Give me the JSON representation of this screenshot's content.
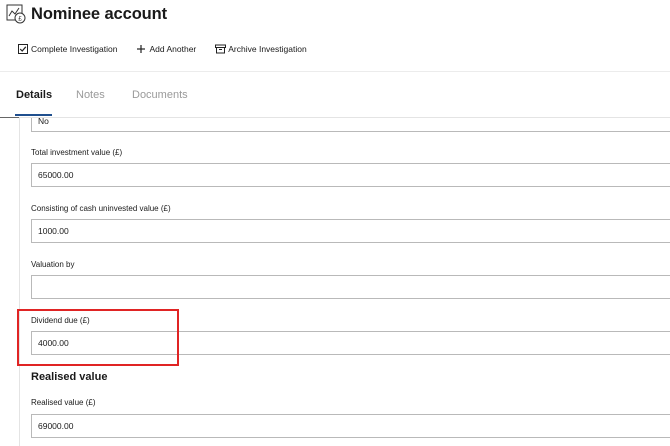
{
  "header": {
    "title": "Nominee account",
    "title_icon": "chart-pound-icon"
  },
  "toolbar": {
    "complete_label": "Complete Investigation",
    "add_label": "Add Another",
    "archive_label": "Archive Investigation"
  },
  "tabs": [
    {
      "label": "Details",
      "active": true
    },
    {
      "label": "Notes",
      "active": false
    },
    {
      "label": "Documents",
      "active": false
    }
  ],
  "fields": {
    "previous_value": "No",
    "total_investment": {
      "label": "Total investment value (£)",
      "value": "65000.00"
    },
    "cash_uninvested": {
      "label": "Consisting of cash uninvested value (£)",
      "value": "1000.00"
    },
    "valuation_by": {
      "label": "Valuation by",
      "value": ""
    },
    "dividend_due": {
      "label": "Dividend due (£)",
      "value": "4000.00"
    }
  },
  "realised": {
    "heading": "Realised value",
    "realised_value": {
      "label": "Realised value (£)",
      "value": "69000.00"
    }
  },
  "colors": {
    "accent": "#1f4f8e",
    "highlight": "#e02424",
    "border": "#b9b9b9"
  }
}
